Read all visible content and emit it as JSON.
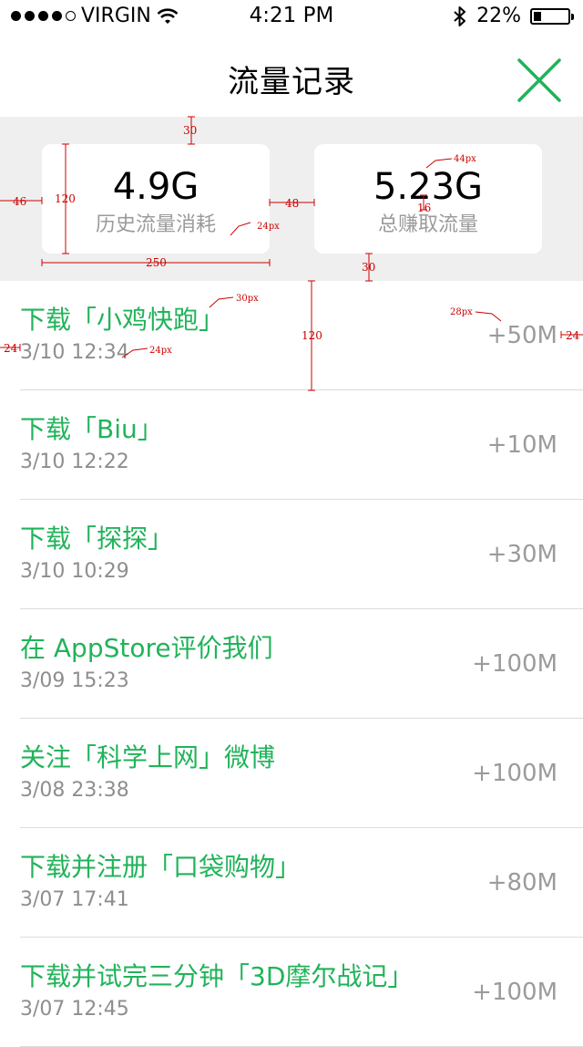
{
  "status_bar": {
    "carrier": "VIRGIN",
    "time": "4:21 PM",
    "battery_percent": "22%",
    "battery_level": 0.22,
    "signal_filled": 4,
    "signal_total": 5
  },
  "header": {
    "title": "流量记录",
    "close_icon": "close-x-icon",
    "accent_color": "#21b35a"
  },
  "summary": {
    "history": {
      "value": "4.9G",
      "label": "历史流量消耗"
    },
    "earned": {
      "value": "5.23G",
      "label": "总赚取流量"
    }
  },
  "annotations": {
    "top_margin": "30",
    "left_margin": "46",
    "card_height": "120",
    "card_gap": "48",
    "card_width": "250",
    "bottom_margin": "30",
    "value_size": "44px",
    "label_size": "24px",
    "value_label_gap": "16",
    "row_height": "120",
    "title_size": "30px",
    "time_size": "24px",
    "amount_size": "28px",
    "left_padding": "24",
    "right_padding": "24"
  },
  "records": [
    {
      "title": "下载「小鸡快跑」",
      "time": "3/10 12:34",
      "amount": "+50M"
    },
    {
      "title": "下载「Biu」",
      "time": "3/10 12:22",
      "amount": "+10M"
    },
    {
      "title": "下载「探探」",
      "time": "3/10 10:29",
      "amount": "+30M"
    },
    {
      "title": "在 AppStore评价我们",
      "time": "3/09 15:23",
      "amount": "+100M"
    },
    {
      "title": "关注「科学上网」微博",
      "time": "3/08 23:38",
      "amount": "+100M"
    },
    {
      "title": "下载并注册「口袋购物」",
      "time": "3/07 17:41",
      "amount": "+80M"
    },
    {
      "title": "下载并试完三分钟「3D摩尔战记」",
      "time": "3/07 12:45",
      "amount": "+100M"
    }
  ]
}
